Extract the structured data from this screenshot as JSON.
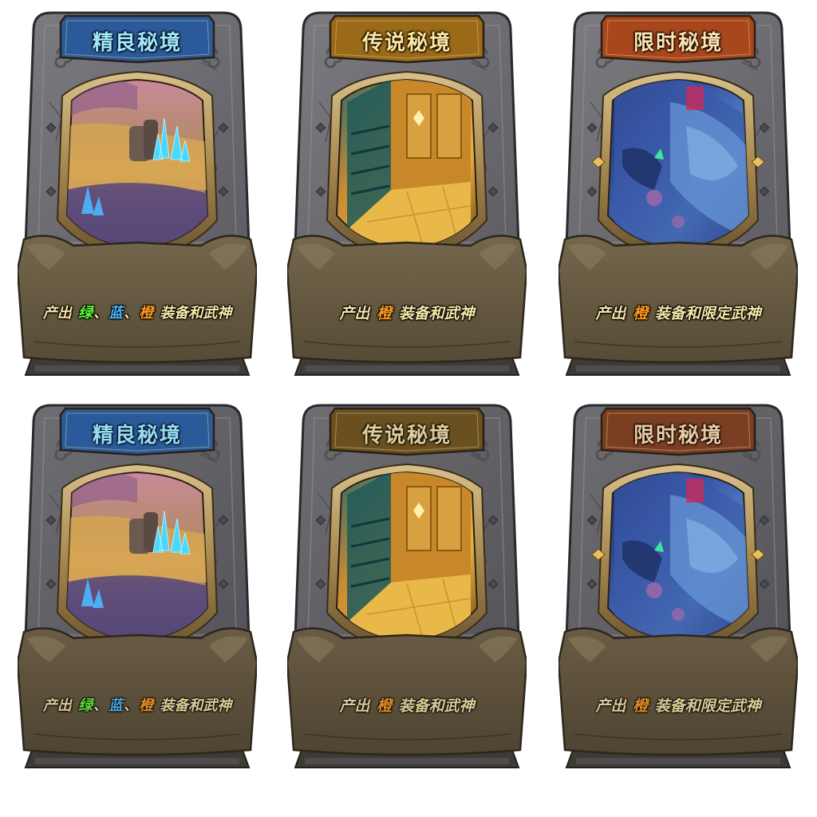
{
  "colors": {
    "green": "#5cff3a",
    "blue": "#4ab8ff",
    "orange": "#ff9a1e",
    "desc_text": "#f5e6a8"
  },
  "cards": [
    {
      "title": "精良秘境",
      "banner_color": "#2a5a9a",
      "title_color": "#9fe8ff",
      "scene": "crystal-cave",
      "desc_prefix": "产出",
      "tiers": [
        "绿",
        "、",
        "蓝",
        "、",
        "橙"
      ],
      "desc_suffix": "装备和武神"
    },
    {
      "title": "传说秘境",
      "banner_color": "#9a6a18",
      "title_color": "#ffe7a0",
      "scene": "golden-hall",
      "desc_prefix": "产出",
      "tiers": [
        "橙"
      ],
      "desc_suffix": "装备和武神"
    },
    {
      "title": "限时秘境",
      "banner_color": "#a8461c",
      "title_color": "#ffe3b0",
      "scene": "blue-ruins",
      "desc_prefix": "产出",
      "tiers": [
        "橙"
      ],
      "desc_suffix": "装备和限定武神"
    },
    {
      "title": "精良秘境",
      "banner_color": "#2a5a9a",
      "title_color": "#9fe8ff",
      "scene": "crystal-cave",
      "desc_prefix": "产出",
      "tiers": [
        "绿",
        "、",
        "蓝",
        "、",
        "橙"
      ],
      "desc_suffix": "装备和武神"
    },
    {
      "title": "传说秘境",
      "banner_color": "#6a5020",
      "title_color": "#e8d9a8",
      "scene": "golden-hall",
      "desc_prefix": "产出",
      "tiers": [
        "橙"
      ],
      "desc_suffix": "装备和武神"
    },
    {
      "title": "限时秘境",
      "banner_color": "#7a3e22",
      "title_color": "#f2d7ae",
      "scene": "blue-ruins",
      "desc_prefix": "产出",
      "tiers": [
        "橙"
      ],
      "desc_suffix": "装备和限定武神"
    }
  ]
}
